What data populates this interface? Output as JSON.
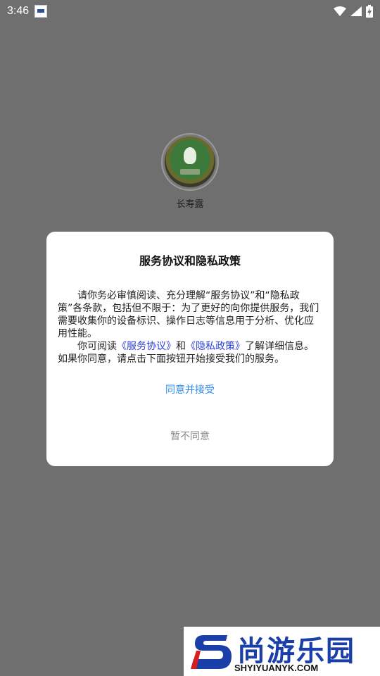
{
  "status_bar": {
    "time": "3:46"
  },
  "app": {
    "name": "长寿露"
  },
  "dialog": {
    "title": "服务协议和隐私政策",
    "para1": "请你务必审慎阅读、充分理解“服务协议”和“隐私政策”各条款，包括但不限于：为了更好的向你提供服务，我们需要收集你的设备标识、操作日志等信息用于分析、优化应用性能。",
    "para2_prefix": "你可阅读",
    "link_service": "《服务协议》",
    "para2_and": "和",
    "link_privacy": "《隐私政策》",
    "para2_suffix": "了解详细信息。如果你同意，请点击下面按钮开始接受我们的服务。",
    "agree_label": "同意并接受",
    "disagree_label": "暂不同意"
  },
  "watermark": {
    "title": "尚游乐园",
    "url": "SHYIYUANYK.COM"
  },
  "colors": {
    "overlay": "#6f6f6f",
    "agree": "#2d8cf0",
    "link": "#2a3fd6",
    "disagree": "#8a8a8a"
  }
}
